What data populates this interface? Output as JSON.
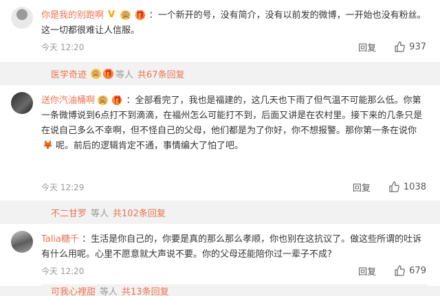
{
  "comments": [
    {
      "username": "你是我的别跑啊",
      "badges": [
        "V",
        "🙊",
        "🎁"
      ],
      "text": "：一个新开的号，没有简介，没有以前发的微博，一开始也没有粉丝。这一切都很难让人信服。",
      "time": "今天 12:20",
      "reply_label": "回复",
      "likes": "937",
      "sub": {
        "user": "医学奇迹",
        "connector": "等人",
        "link": "共67条回复"
      }
    },
    {
      "username": "送你汽油桶啊",
      "badges": [
        "🙊",
        "🎁"
      ],
      "text": "：全部看完了，我也是福建的，这几天也下雨了但气温不可能那么低。你第一条微博说到6点打不到滴滴，在福州怎么可能打不到，后面又讲是在农村里。接下来的几条只是在说自己多么不幸啊，但不怪自己的父母，他们都是为了你好，你不想报警。那你第一条在说你",
      "text_tail": "呢。前后的逻辑肯定不通，事情编大了怕了吧。",
      "inline_emoji": "🦊",
      "time": "今天 12:29",
      "reply_label": "回复",
      "likes": "1038",
      "sub": {
        "user": "不二甘罗",
        "connector": "等人",
        "link": "共102条回复"
      }
    },
    {
      "username": "Talia糖千",
      "badges": [],
      "text": "：生活是你自己的，你要是真的那么那么孝顺，你也别在这抗议了。做这些所谓的吐诉有什么用呢。心里不愿意就大声说不要。你的父母还能陪你过一辈子不成?",
      "time": "今天 12:20",
      "reply_label": "回复",
      "likes": "679",
      "sub": {
        "user": "可我心裡甜",
        "connector": "等人",
        "link": "共13条回复"
      }
    }
  ],
  "colors": {
    "accent": "#eb7350",
    "muted": "#999999",
    "background": "#f2f2f2"
  },
  "icons": {
    "like": "thumbs-up-icon"
  }
}
